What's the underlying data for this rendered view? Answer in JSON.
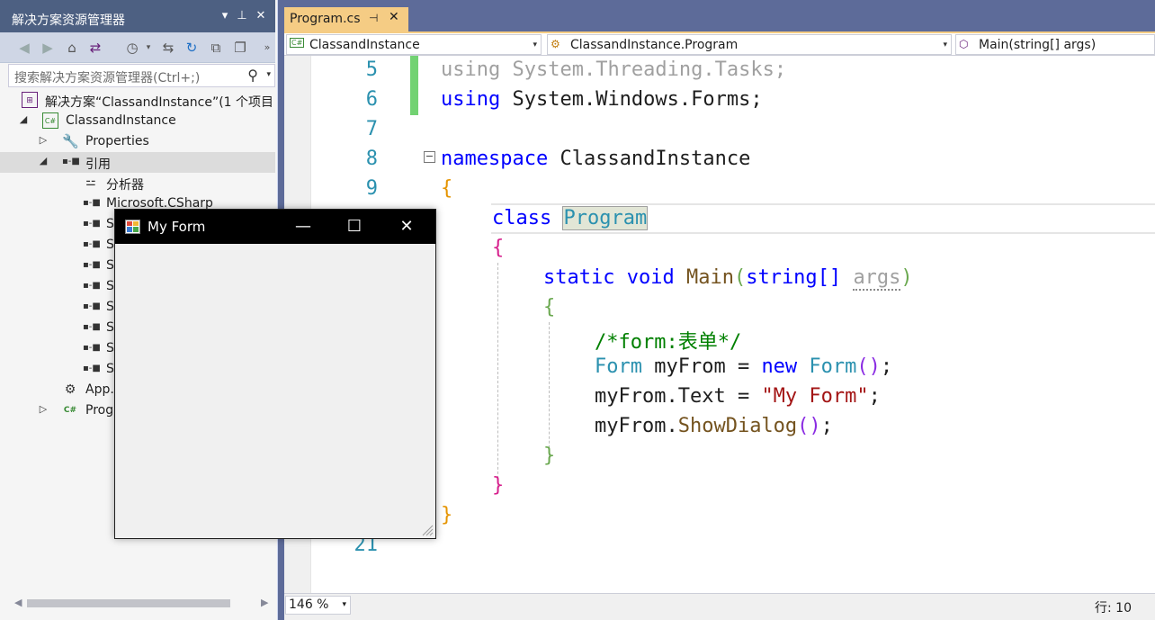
{
  "solution_explorer": {
    "title": "解决方案资源管理器",
    "title_buttons": [
      "▾",
      "⊥",
      "✕"
    ],
    "search_placeholder": "搜索解决方案资源管理器(Ctrl+;)",
    "tree": [
      {
        "label": "解决方案“ClassandInstance”(1 个项目",
        "icon": "solution-icon",
        "expand": ""
      },
      {
        "label": "ClassandInstance",
        "icon": "csharp-project-icon",
        "expand": "◢"
      },
      {
        "label": "Properties",
        "icon": "wrench-icon",
        "expand": "▷"
      },
      {
        "label": "引用",
        "icon": "reference-icon",
        "expand": "◢"
      },
      {
        "label": "分析器",
        "icon": "analyzer-icon",
        "expand": ""
      },
      {
        "label": "Microsoft.CSharp",
        "icon": "reference-icon",
        "expand": ""
      },
      {
        "label": "S",
        "icon": "reference-icon",
        "expand": ""
      },
      {
        "label": "S",
        "icon": "reference-icon",
        "expand": ""
      },
      {
        "label": "S",
        "icon": "reference-icon",
        "expand": ""
      },
      {
        "label": "S",
        "icon": "reference-icon",
        "expand": ""
      },
      {
        "label": "S",
        "icon": "reference-icon",
        "expand": ""
      },
      {
        "label": "S",
        "icon": "reference-icon",
        "expand": ""
      },
      {
        "label": "S",
        "icon": "reference-icon",
        "expand": ""
      },
      {
        "label": "S",
        "icon": "reference-icon",
        "expand": ""
      },
      {
        "label": "App.",
        "icon": "config-icon",
        "expand": ""
      },
      {
        "label": "Prog",
        "icon": "csharp-file-icon",
        "expand": "▷"
      }
    ]
  },
  "editor": {
    "tab": {
      "label": "Program.cs",
      "pin": "⊣",
      "close": "✕"
    },
    "nav": {
      "project": "ClassandInstance",
      "class": "ClassandInstance.Program",
      "member": "Main(string[] args)"
    },
    "line_numbers": [
      "5",
      "6",
      "7",
      "8",
      "9",
      "",
      "",
      "",
      "",
      "",
      "",
      "",
      "",
      "",
      "",
      "21"
    ],
    "code": {
      "l5_kw": "using",
      "l5_rest": " System.Threading.Tasks;",
      "l6_kw": "using",
      "l6_rest": " System.Windows.Forms;",
      "l8_kw": "namespace",
      "l8_rest": " ClassandInstance",
      "l9": "{",
      "l10_kw": "class",
      "l10_type": "Program",
      "l11": "{",
      "l12_kw1": "static",
      "l12_kw2": "void",
      "l12_method": "Main",
      "l12_open": "(",
      "l12_kw3": "string",
      "l12_br": "[]",
      "l12_param": "args",
      "l12_close": ")",
      "l13": "{",
      "l14_comment": "/*form:表单*/",
      "l15_type1": "Form",
      "l15_mid": " myFrom = ",
      "l15_kw": "new",
      "l15_type2": " Form",
      "l15_paren": "()",
      "l15_end": ";",
      "l16_pre": "myFrom.Text = ",
      "l16_str": "\"My Form\"",
      "l16_end": ";",
      "l17_pre": "myFrom.",
      "l17_method": "ShowDialog",
      "l17_paren": "()",
      "l17_end": ";",
      "l18": "}",
      "l19": "}",
      "l20": "}"
    },
    "status": {
      "zoom": "146 %",
      "position": "行: 10"
    }
  },
  "dialog": {
    "title": "My Form",
    "minimize": "—",
    "maximize": "☐",
    "close": "✕"
  },
  "colors": {
    "keyword": "#0000ff",
    "type": "#2b91af",
    "string": "#a31515",
    "comment": "#008000",
    "method": "#74531f",
    "tab_active": "#f5cc84",
    "title_bar": "#4d6082"
  }
}
